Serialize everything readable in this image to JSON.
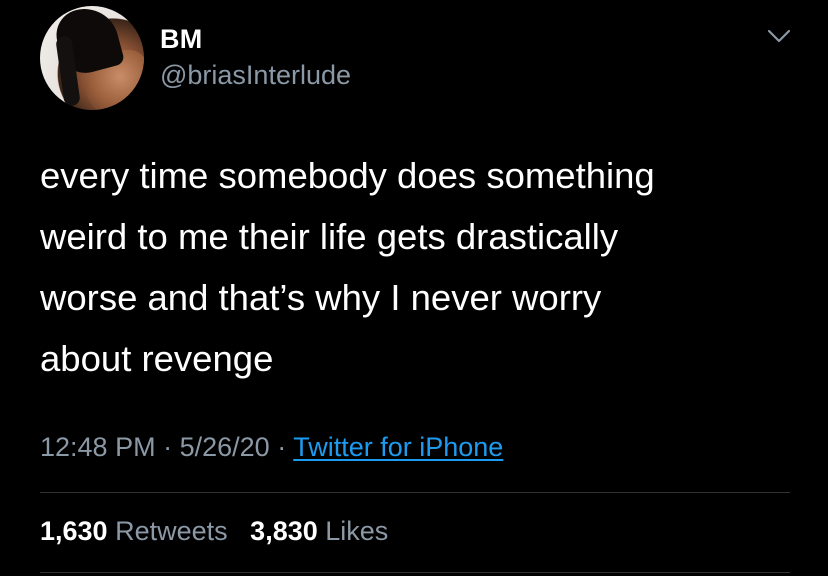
{
  "author": {
    "display_name": "BM",
    "handle": "@briasInterlude"
  },
  "tweet": {
    "text": "every time somebody does something\nweird to me their life gets drastically\nworse and that’s why I never worry\nabout revenge",
    "time": "12:48 PM",
    "date": "5/26/20",
    "separator": "·",
    "source": "Twitter for iPhone"
  },
  "stats": {
    "retweets_count": "1,630",
    "retweets_label": "Retweets",
    "likes_count": "3,830",
    "likes_label": "Likes"
  },
  "icons": {
    "menu": "chevron-down-icon"
  },
  "colors": {
    "background": "#000000",
    "text_primary": "#ffffff",
    "text_secondary": "#8b98a5",
    "link": "#1d9bf0"
  }
}
